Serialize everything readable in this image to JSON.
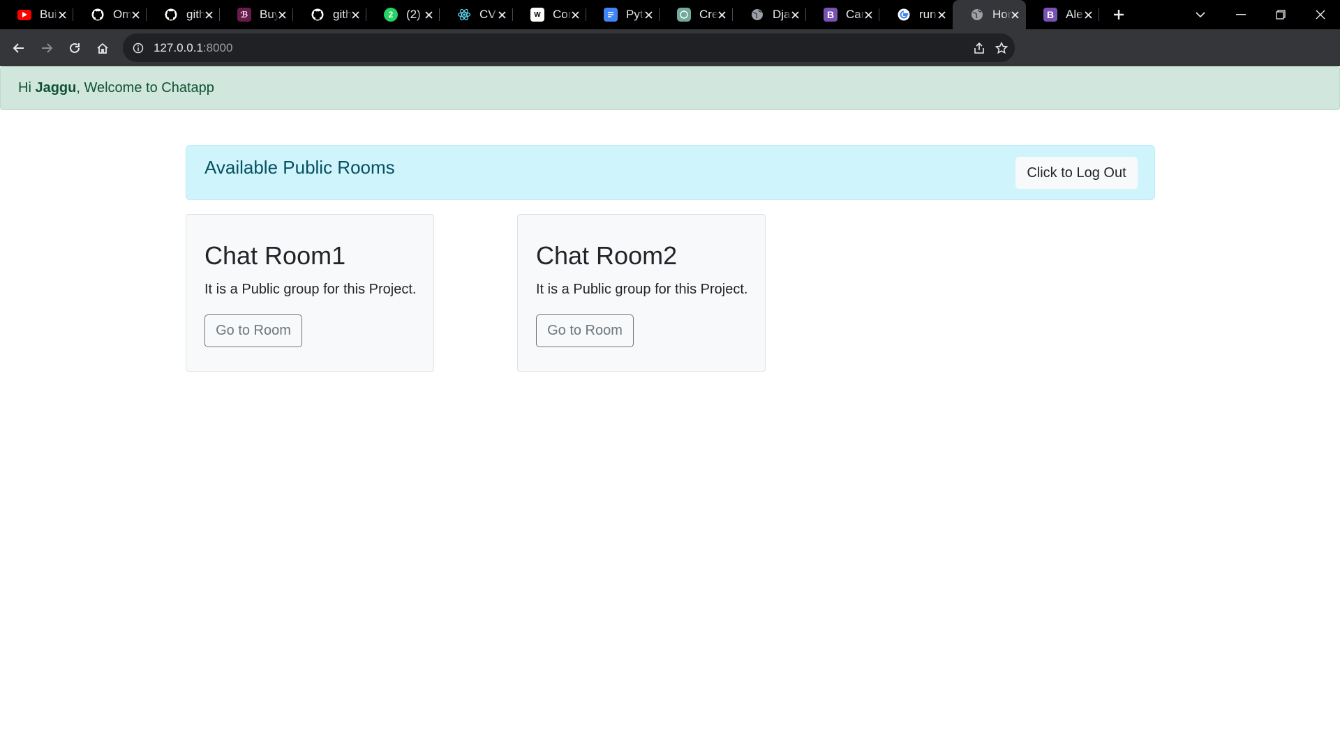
{
  "browser": {
    "tabs": [
      {
        "title": "Buil",
        "icon": "youtube-icon",
        "color": "#ff0000"
      },
      {
        "title": "Om",
        "icon": "github-icon",
        "color": "#ffffff"
      },
      {
        "title": "gith",
        "icon": "github-icon",
        "color": "#ffffff"
      },
      {
        "title": "Buy",
        "icon": "buymeacoffee-icon",
        "color": "#6a1b4d"
      },
      {
        "title": "gith",
        "icon": "github-icon",
        "color": "#ffffff"
      },
      {
        "title": "(2) \\",
        "icon": "whatsapp-icon",
        "color": "#25d366"
      },
      {
        "title": "CV",
        "icon": "react-icon",
        "color": "#61dafb"
      },
      {
        "title": "Con",
        "icon": "w3-icon",
        "color": "#ffffff"
      },
      {
        "title": "Pyth",
        "icon": "docs-icon",
        "color": "#4285f4"
      },
      {
        "title": "Cre",
        "icon": "openai-icon",
        "color": "#74aa9c"
      },
      {
        "title": "Dja",
        "icon": "globe-icon",
        "color": "#9aa0a6"
      },
      {
        "title": "Car",
        "icon": "bootstrap-icon",
        "color": "#7952b3"
      },
      {
        "title": "run",
        "icon": "google-icon",
        "color": "#4285f4"
      },
      {
        "title": "Hor",
        "icon": "globe-icon",
        "color": "#9aa0a6",
        "active": true
      },
      {
        "title": "Ale",
        "icon": "bootstrap-icon",
        "color": "#7952b3"
      }
    ],
    "url_host": "127.0.0.1",
    "url_port": ":8000"
  },
  "welcome": {
    "prefix": "Hi ",
    "username": "Jaggu",
    "suffix": ", Welcome to Chatapp"
  },
  "rooms": {
    "title": "Available Public Rooms",
    "logout_label": "Click to Log Out",
    "items": [
      {
        "name": "Chat Room1",
        "description": "It is a Public group for this Project.",
        "button": "Go to Room"
      },
      {
        "name": "Chat Room2",
        "description": "It is a Public group for this Project.",
        "button": "Go to Room"
      }
    ]
  }
}
